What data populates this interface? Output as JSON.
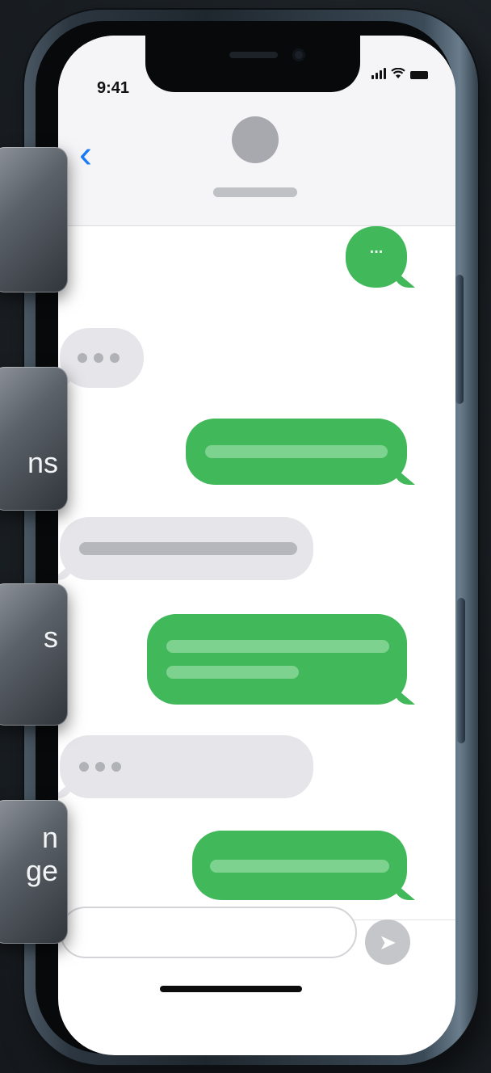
{
  "status_bar": {
    "time": "9:41"
  },
  "header": {
    "back_icon": "chevron-left-icon"
  },
  "messages": [
    {
      "side": "sent",
      "content": "..."
    },
    {
      "side": "received",
      "content": "typing-dots"
    },
    {
      "side": "sent",
      "content": "text-placeholder"
    },
    {
      "side": "received",
      "content": "text-placeholder"
    },
    {
      "side": "sent",
      "content": "text-placeholder"
    },
    {
      "side": "received",
      "content": "typing-dots"
    },
    {
      "side": "sent",
      "content": "text-placeholder"
    }
  ],
  "composer": {
    "send_icon": "send-arrow-icon"
  },
  "side_cards": [
    {
      "text": ""
    },
    {
      "text": "ns"
    },
    {
      "text": "s"
    },
    {
      "text": "n\nge"
    }
  ],
  "colors": {
    "sent_bubble": "#41b85a",
    "received_bubble": "#e6e6ea",
    "accent": "#1a7cf5",
    "frame": "#2c3640"
  }
}
